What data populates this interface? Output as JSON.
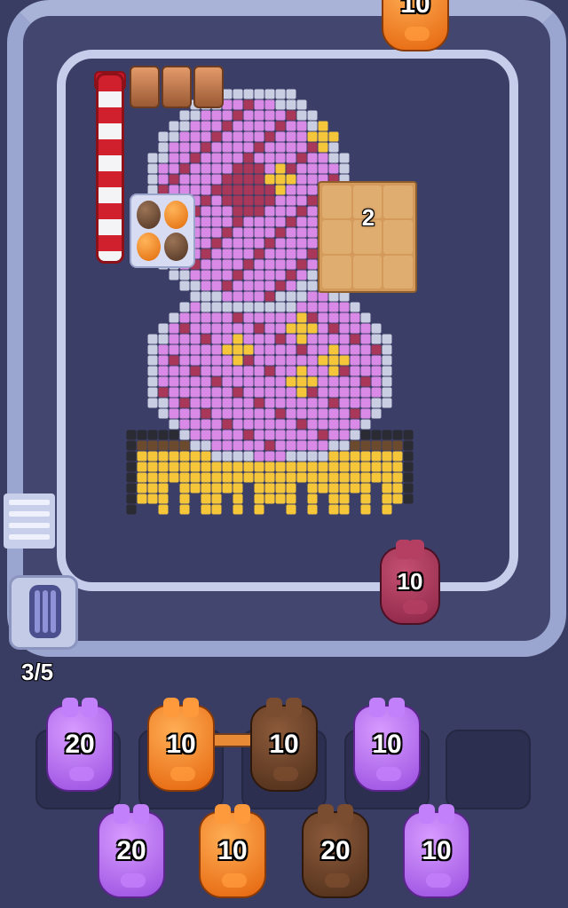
{
  "level_progress": "3/5",
  "top_pig": {
    "count": "10",
    "color": "orange"
  },
  "track_pig": {
    "count": "10",
    "color": "maroon"
  },
  "box_block": {
    "count": "2"
  },
  "slot_row": [
    {
      "count": "20",
      "color": "purple"
    },
    {
      "count": "10",
      "color": "orange"
    },
    {
      "count": "10",
      "color": "brown"
    },
    {
      "count": "10",
      "color": "purple"
    },
    {
      "count": "",
      "color": "empty"
    }
  ],
  "queue_row": [
    {
      "count": "20",
      "color": "purple"
    },
    {
      "count": "10",
      "color": "orange"
    },
    {
      "count": "20",
      "color": "brown"
    },
    {
      "count": "10",
      "color": "purple"
    }
  ],
  "colors": {
    "background": "#3a3d63",
    "track": "#9aa6cf",
    "pink": "#d98ae6",
    "maroon": "#a8375a",
    "yellow": "#f5c63a",
    "dark": "#2b2b33",
    "light": "#c9cee3",
    "brownish": "#6b4a2e"
  }
}
